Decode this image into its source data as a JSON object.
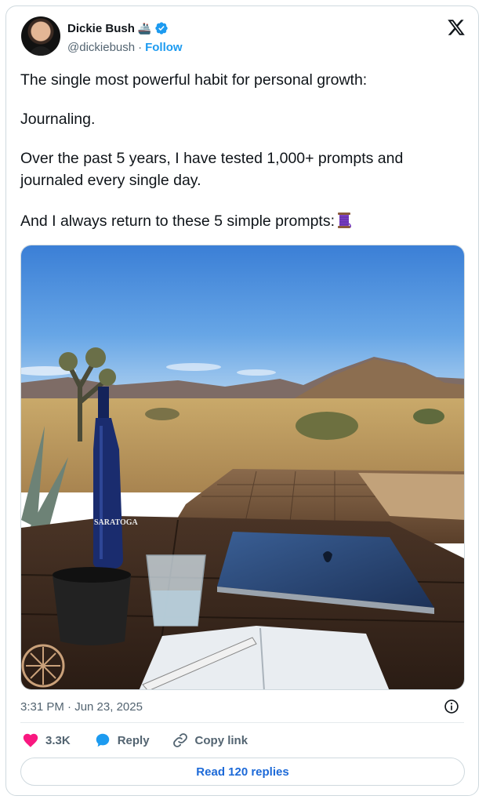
{
  "author": {
    "name": "Dickie Bush",
    "name_emoji": "🚢",
    "handle": "@dickiebush",
    "separator": "·",
    "follow_label": "Follow"
  },
  "tweet": {
    "paragraphs": [
      "The single most powerful habit for personal growth:",
      "Journaling.",
      "Over the past 5 years, I have tested 1,000+ prompts and journaled every single day.",
      "And I always return to these 5 simple prompts:"
    ],
    "bottle_label": "SARATOGA",
    "timestamp": "3:31 PM · Jun 23, 2025"
  },
  "actions": {
    "like_count": "3.3K",
    "reply_label": "Reply",
    "copy_link_label": "Copy link"
  },
  "read_replies_label": "Read 120 replies",
  "colors": {
    "accent": "#1d9bf0",
    "like": "#f91880",
    "text": "#0f1419",
    "muted": "#536471"
  }
}
